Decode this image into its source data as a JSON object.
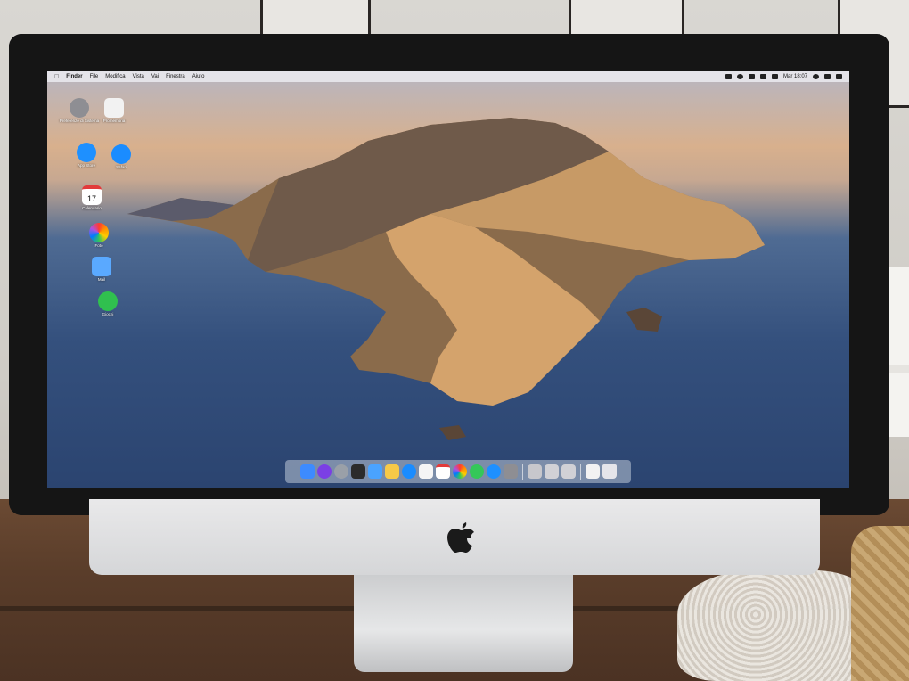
{
  "menubar": {
    "items": [
      "Finder",
      "File",
      "Modifica",
      "Vista",
      "Vai",
      "Finestra",
      "Aiuto"
    ],
    "clock": "Mar 18:07"
  },
  "desktop_icons": [
    {
      "label": "Preferenze di Sistema",
      "icon": "system-preferences-icon",
      "color": "#8e8e93"
    },
    {
      "label": "Promemoria",
      "icon": "reminders-icon",
      "color": "#f2f2f2"
    },
    {
      "label": "App Store",
      "icon": "app-store-icon",
      "color": "#1e90ff"
    },
    {
      "label": "Safari",
      "icon": "safari-icon",
      "color": "#1a8cff"
    },
    {
      "label": "Calendario",
      "icon": "calendar-icon",
      "color": "#ffffff",
      "badge": "17"
    },
    {
      "label": "Foto",
      "icon": "photos-icon",
      "color": "#ffffff"
    },
    {
      "label": "Mail",
      "icon": "mail-icon",
      "color": "#5aa9ff"
    },
    {
      "label": "Giochi",
      "icon": "game-center-icon",
      "color": "#30c04f"
    }
  ],
  "dock": {
    "items": [
      {
        "icon": "finder-icon",
        "color": "#3d8bff"
      },
      {
        "icon": "siri-icon",
        "color": "#7b3fe4"
      },
      {
        "icon": "launchpad-icon",
        "color": "#9aa0a8"
      },
      {
        "icon": "mission-control-icon",
        "color": "#2b2b2b"
      },
      {
        "icon": "preview-icon",
        "color": "#4aa3ff"
      },
      {
        "icon": "notes-icon",
        "color": "#f7c948"
      },
      {
        "icon": "safari-icon",
        "color": "#1a8cff"
      },
      {
        "icon": "reminders-icon",
        "color": "#f5f5f5"
      },
      {
        "icon": "calendar-icon",
        "color": "#ffffff"
      },
      {
        "icon": "photos-icon",
        "color": "#ff9f0a"
      },
      {
        "icon": "messages-icon",
        "color": "#34c759"
      },
      {
        "icon": "app-store-icon",
        "color": "#1e90ff"
      },
      {
        "icon": "system-preferences-icon",
        "color": "#8e8e93"
      },
      {
        "icon": "scissors-icon",
        "color": "#c7c7cc"
      },
      {
        "icon": "printer-icon",
        "color": "#d1d1d6"
      },
      {
        "icon": "printer-2-icon",
        "color": "#d1d1d6"
      },
      {
        "icon": "documents-icon",
        "color": "#f2f2f2"
      },
      {
        "icon": "trash-icon",
        "color": "#e5e5ea"
      }
    ]
  }
}
